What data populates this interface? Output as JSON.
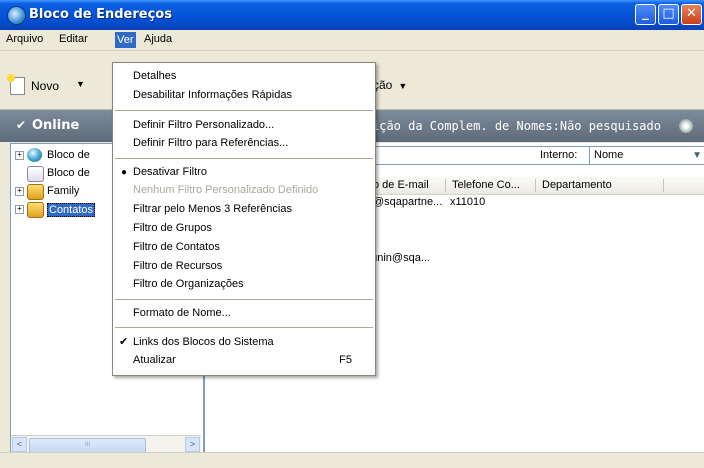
{
  "window": {
    "title": "Bloco de Endereços",
    "btn_min": "_",
    "btn_max": "□",
    "btn_close": "✕"
  },
  "menubar": {
    "items": [
      "Arquivo",
      "Editar",
      "Ver",
      "Ajuda"
    ]
  },
  "toolbar": {
    "novo_label": "Novo",
    "acao_label": "ção",
    "dropdown_arrow": "▼"
  },
  "statusbar": {
    "online_label": "Online",
    "search_status": "ição da Complem. de Nomes:Não pesquisado"
  },
  "tree": {
    "items": [
      {
        "label": "Bloco de",
        "icon": "globe-icon"
      },
      {
        "label": "Bloco de",
        "icon": "sync-arrow-icon"
      },
      {
        "label": "Family",
        "icon": "address-book-icon"
      },
      {
        "label": "Contatos",
        "icon": "address-book-icon",
        "selected": true
      }
    ],
    "scroll_left": "<",
    "scroll_right": ">",
    "scroll_grip": "III"
  },
  "filter": {
    "interno_label": "Interno:",
    "interno_value": "Nome"
  },
  "table": {
    "columns": [
      "o de E-mail",
      "Telefone Co...",
      "Departamento"
    ],
    "rows": [
      [
        "@sqapartne...",
        "x11010",
        ""
      ],
      [
        "ounin@sqa...",
        "",
        ""
      ]
    ]
  },
  "ver_menu": {
    "detalhes": "Detalhes",
    "desabilitar": "Desabilitar Informações Rápidas",
    "definir_personalizado": "Definir Filtro Personalizado...",
    "definir_referencias": "Definir Filtro para Referências...",
    "desativar": "Desativar Filtro",
    "nenhum": "Nenhum Filtro Personalizado Definido",
    "filtrar_3": "Filtrar pelo Menos 3 Referências",
    "filtro_grupos": "Filtro de Grupos",
    "filtro_contatos": "Filtro de Contatos",
    "filtro_recursos": "Filtro de Recursos",
    "filtro_organizacoes": "Filtro de Organizações",
    "formato_nome": "Formato de Nome...",
    "links_blocos": "Links dos Blocos do Sistema",
    "atualizar": "Atualizar",
    "atualizar_shortcut": "F5",
    "bullet": "●",
    "check": "✔"
  }
}
